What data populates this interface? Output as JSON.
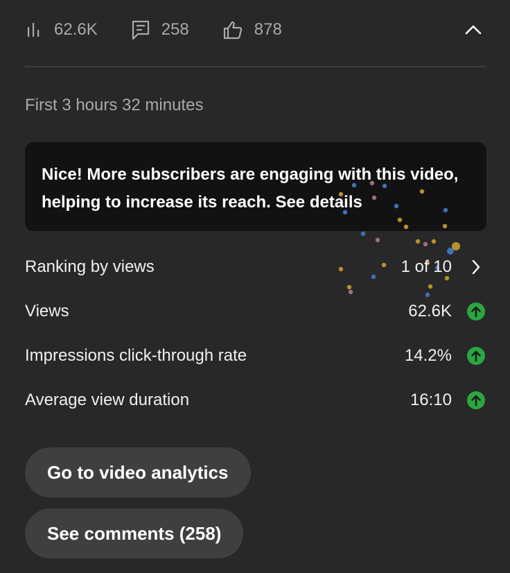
{
  "stats": {
    "views": "62.6K",
    "comments": "258",
    "likes": "878"
  },
  "period": "First 3 hours 32 minutes",
  "insight": {
    "text": "Nice! More subscribers are engaging with this video, helping to increase its reach.",
    "link": "See details"
  },
  "metrics": [
    {
      "label": "Ranking by views",
      "value": "1 of 10",
      "trail_icon": "chevron-right-icon"
    },
    {
      "label": "Views",
      "value": "62.6K",
      "trail_icon": "arrow-up-circle-icon"
    },
    {
      "label": "Impressions click-through rate",
      "value": "14.2%",
      "trail_icon": "arrow-up-circle-icon"
    },
    {
      "label": "Average view duration",
      "value": "16:10",
      "trail_icon": "arrow-up-circle-icon"
    }
  ],
  "buttons": {
    "analytics": "Go to video analytics",
    "comments": "See comments (258)"
  },
  "colors": {
    "background": "#282828",
    "card": "#121212",
    "pill": "#3f3f3f",
    "trend_up": "#2ba640",
    "muted_text": "#aaaaaa"
  }
}
